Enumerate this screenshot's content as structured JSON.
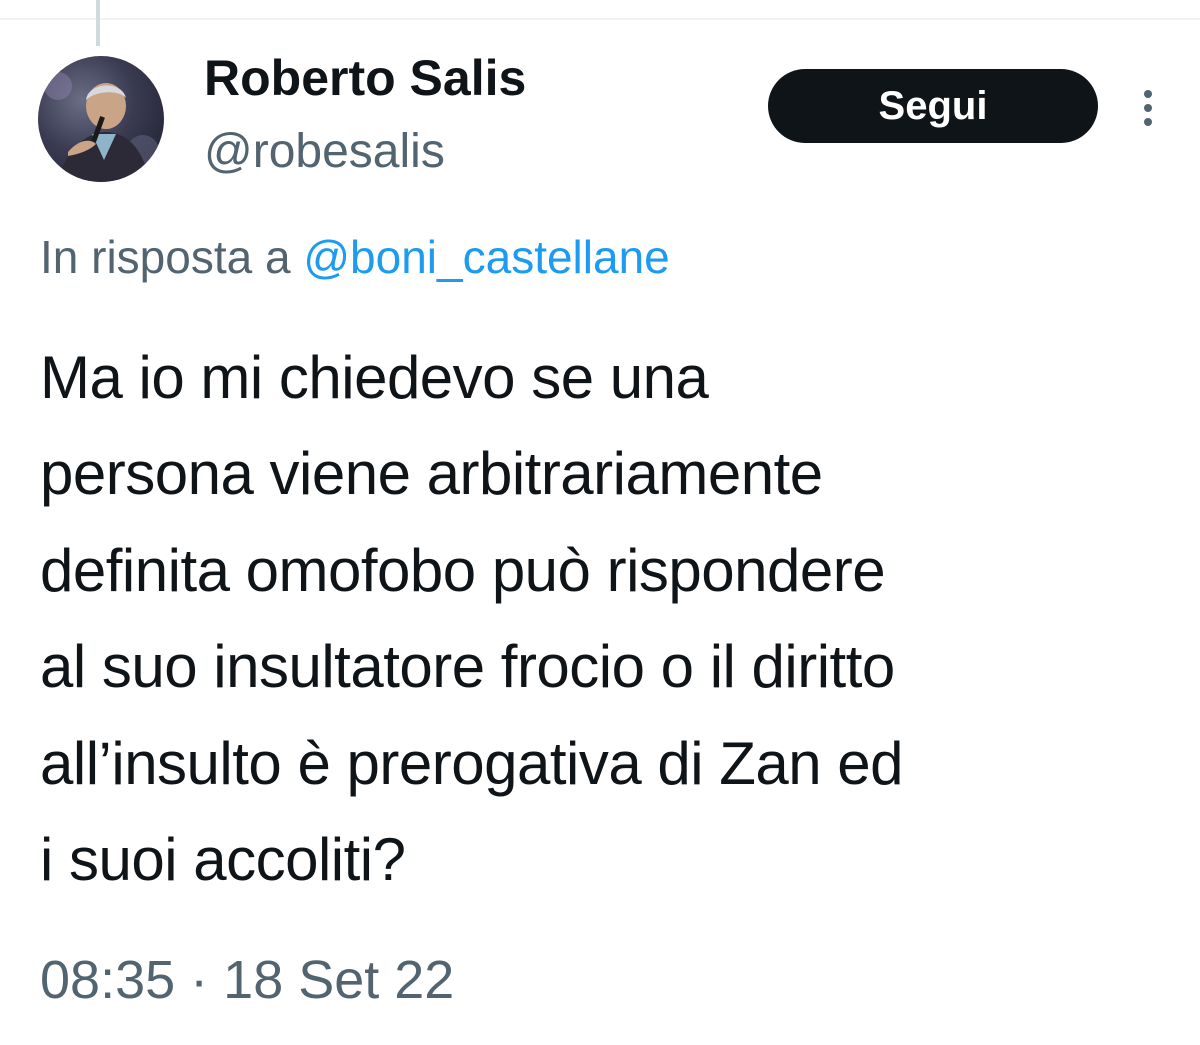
{
  "tweet": {
    "author": {
      "name": "Roberto Salis",
      "handle": "@robesalis"
    },
    "follow_label": "Segui",
    "reply": {
      "prefix": "In risposta a ",
      "mention": "@boni_castellane"
    },
    "text_lines": [
      "Ma io mi chiedevo se una",
      "persona viene arbitrariamente",
      "definita omofobo può rispondere",
      "al suo insultatore frocio o il diritto",
      "all’insulto è prerogativa di Zan ed",
      "i suoi accoliti?"
    ],
    "time": "08:35",
    "separator": "·",
    "date": "18 Set 22"
  },
  "icons": {
    "more": "more-vertical-icon",
    "avatar": "profile-photo"
  },
  "colors": {
    "text": "#0f1419",
    "secondary": "#536471",
    "link": "#1d9bf0",
    "button": "#0f1419"
  }
}
